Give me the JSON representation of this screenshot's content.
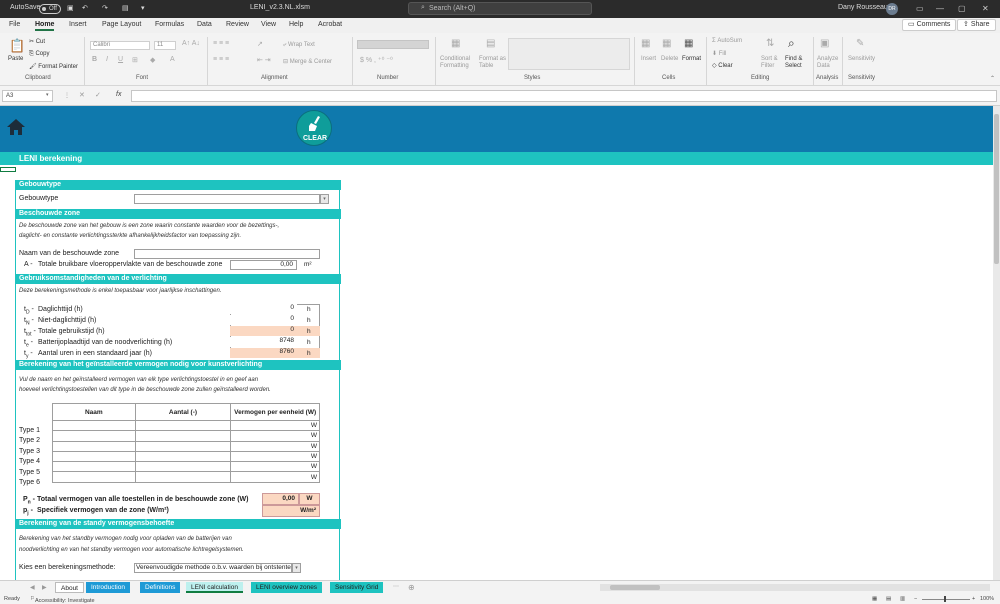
{
  "titlebar": {
    "autosave_label": "AutoSave",
    "autosave_state": "Off",
    "filename": "LENI_v2.3.NL.xlsm",
    "search_placeholder": "Search (Alt+Q)",
    "user_name": "Dany Rousseau",
    "user_initials": "DR"
  },
  "menu": {
    "tabs": [
      "File",
      "Home",
      "Insert",
      "Page Layout",
      "Formulas",
      "Data",
      "Review",
      "View",
      "Help",
      "Acrobat"
    ],
    "active": "Home",
    "comments_label": "Comments",
    "share_label": "Share"
  },
  "ribbon": {
    "paste": "Paste",
    "cut": "Cut",
    "copy": "Copy",
    "format_painter": "Format Painter",
    "clipboard_group": "Clipboard",
    "font_name": "Calibri",
    "font_size": "11",
    "font_group": "Font",
    "wrap_text": "Wrap Text",
    "merge_center": "Merge & Center",
    "alignment_group": "Alignment",
    "number_group": "Number",
    "conditional_formatting": "Conditional Formatting",
    "format_as_table": "Format as Table",
    "styles_group": "Styles",
    "insert": "Insert",
    "delete": "Delete",
    "format": "Format",
    "cells_group": "Cells",
    "autosum": "AutoSum",
    "fill": "Fill",
    "clear": "Clear",
    "sort_filter": "Sort & Filter",
    "find_select": "Find & Select",
    "editing_group": "Editing",
    "analyze_data": "Analyze Data",
    "analysis_group": "Analysis",
    "sensitivity": "Sensitivity",
    "sensitivity_group": "Sensitivity"
  },
  "formula_bar": {
    "cell_ref": "A3",
    "fx": "fx"
  },
  "sheet": {
    "clear_label": "CLEAR",
    "header_title": "LENI berekening",
    "sections": {
      "gebouwtype": "Gebouwtype",
      "beschouwde_zone": "Beschouwde zone",
      "gebruik": "Gebruiksomstandigheden van de verlichting",
      "vermogen": "Berekening van het geïnstalleerde vermogen nodig voor kunstverlichting",
      "standby": "Berekening van de standy vermogensbehoefte"
    },
    "gebouwtype_label": "Gebouwtype",
    "zone_desc_1": "De beschouwde zone van het gebouw is een zone waarin constante waarden voor de bezettings-,",
    "zone_desc_2": "daglicht- en constante verlichtingssterkte afhankelijkheidsfactor van toepassing zijn.",
    "zone_name_label": "Naam van de beschouwde zone",
    "area_prefix": "A -",
    "area_label": "Totale bruikbare vloeroppervlakte van de beschouwde zone",
    "area_value": "0,00",
    "area_unit": "m²",
    "gebruik_note": "Deze berekeningsmethode is enkel toepasbaar voor jaarlijkse inschattingen.",
    "usage_rows": [
      {
        "sym": "t",
        "sub": "D",
        "label": "Daglichttijd (h)",
        "value": "0",
        "unit": "h"
      },
      {
        "sym": "t",
        "sub": "N",
        "label": "Niet-daglichttijd (h)",
        "value": "0",
        "unit": "h"
      },
      {
        "sym": "t",
        "sub": "tot",
        "label": "Totale gebruikstijd (h)",
        "value": "0",
        "unit": "h"
      },
      {
        "sym": "t",
        "sub": "e",
        "label": "Batterijoplaadtijd van de noodverlichting (h)",
        "value": "8748",
        "unit": "h"
      },
      {
        "sym": "t",
        "sub": "y",
        "label": "Aantal uren in een standaard jaar (h)",
        "value": "8760",
        "unit": "h"
      }
    ],
    "vermogen_desc_1": "Vul de naam en het geïnstalleerd vermogen van elk type verlichtingstoestel in en geef aan",
    "vermogen_desc_2": "hoeveel verlichtingstoestellen van dit type in de beschouwde zone zullen geïnstalleerd worden.",
    "table_headers": [
      "Naam",
      "Aantal (-)",
      "Vermogen per eenheid (W)"
    ],
    "table_rows": [
      "Type 1",
      "Type 2",
      "Type 3",
      "Type 4",
      "Type 5",
      "Type 6"
    ],
    "watt_unit": "W",
    "pn_sym": "P",
    "pn_sub": "n",
    "pn_label": "Totaal vermogen van alle toestellen in de beschouwde zone (W)",
    "pn_value": "0,00",
    "pn_unit": "W",
    "pj_sym": "p",
    "pj_sub": "j",
    "pj_label": "Specifiek vermogen van de zone (W/m²)",
    "pj_unit": "W/m²",
    "standby_desc_1": "Berekening van het standby vermogen nodig voor opladen van de batterijen van",
    "standby_desc_2": "noodverlichting en van het standby vermogen voor automatische lichtregelsystemen.",
    "method_label": "Kies een berekeningsmethode:",
    "method_value": "Vereenvoudigde methode o.b.v. waarden bij ontstentenis"
  },
  "sheet_tabs": [
    "About",
    "Introduction",
    "Definitions",
    "LENI calculation",
    "LENI overview zones",
    "Sensitivity Grid"
  ],
  "status": {
    "ready": "Ready",
    "accessibility": "Accessibility: Investigate",
    "zoom": "100%"
  }
}
